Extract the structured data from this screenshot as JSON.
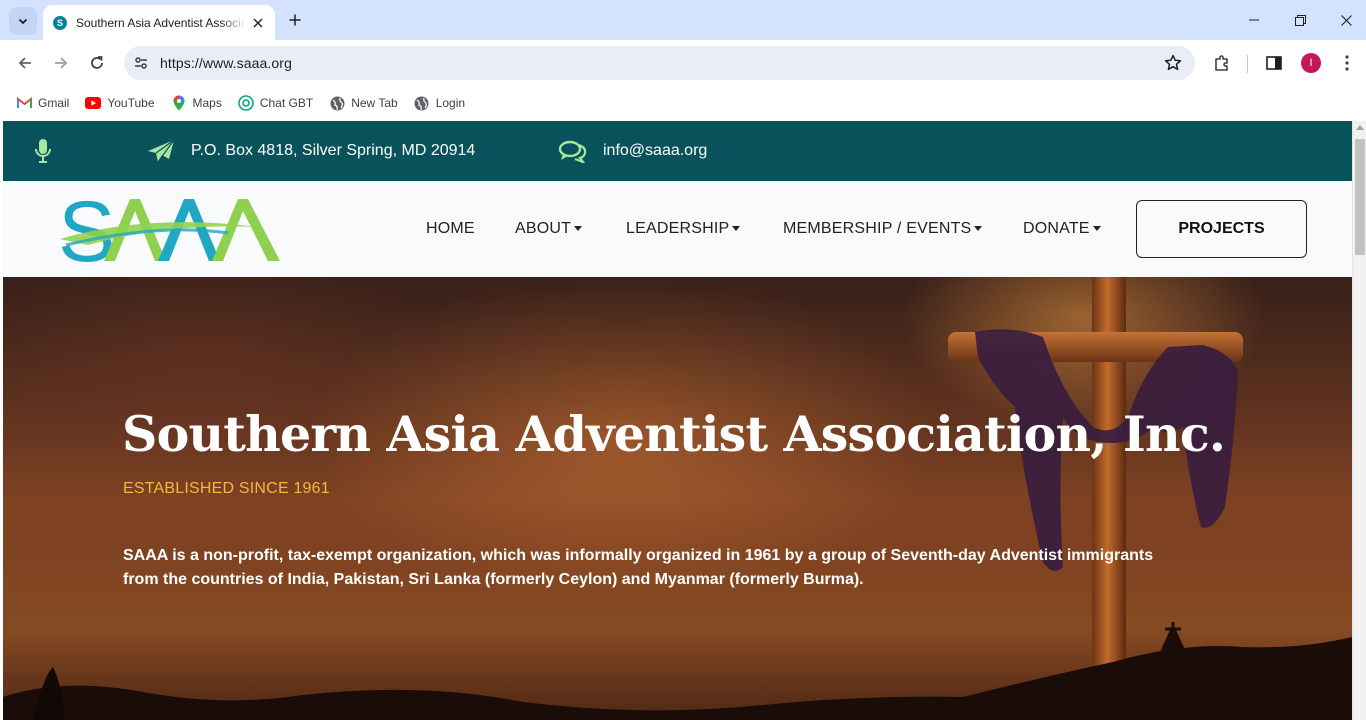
{
  "browser": {
    "tab_title": "Southern Asia Adventist Associa",
    "url": "https://www.saaa.org",
    "profile_initial": "I",
    "bookmarks": [
      {
        "label": "Gmail",
        "icon": "gmail-icon"
      },
      {
        "label": "YouTube",
        "icon": "youtube-icon"
      },
      {
        "label": "Maps",
        "icon": "maps-icon"
      },
      {
        "label": "Chat GBT",
        "icon": "chatgpt-icon"
      },
      {
        "label": "New Tab",
        "icon": "globe-icon"
      },
      {
        "label": "Login",
        "icon": "globe-icon"
      }
    ]
  },
  "topbar": {
    "address": "P.O. Box 4818, Silver Spring, MD 20914",
    "email": "info@saaa.org"
  },
  "nav": {
    "logo_text": "SAAA",
    "items": [
      {
        "label": "HOME",
        "dropdown": false
      },
      {
        "label": "ABOUT",
        "dropdown": true
      },
      {
        "label": "LEADERSHIP",
        "dropdown": true
      },
      {
        "label": "MEMBERSHIP / EVENTS",
        "dropdown": true
      },
      {
        "label": "DONATE",
        "dropdown": true
      }
    ],
    "cta": "PROJECTS"
  },
  "hero": {
    "title": "Southern Asia Adventist Association, Inc.",
    "subtitle": "ESTABLISHED SINCE 1961",
    "description": "SAAA is a non-profit, tax-exempt organization, which was informally organized in 1961 by a group of Seventh-day Adventist immigrants from the countries of India, Pakistan, Sri Lanka (formerly Ceylon) and Myanmar (formerly Burma)."
  },
  "colors": {
    "topbar_bg": "#08535b",
    "subtitle": "#f5b83d",
    "icon_green": "#a8e6a0",
    "logo_teal": "#1fa7c4",
    "logo_green": "#8fd14f"
  }
}
